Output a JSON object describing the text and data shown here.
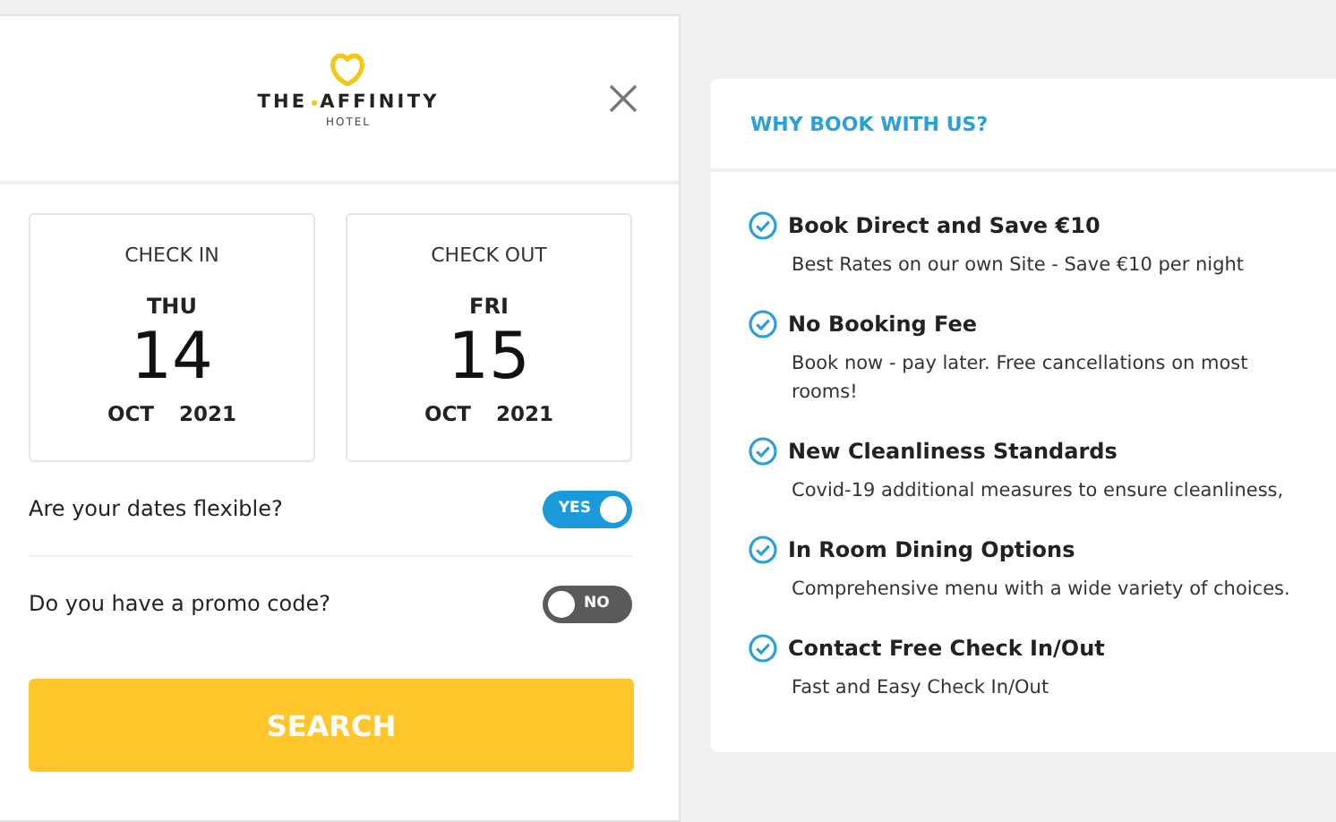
{
  "logo": {
    "words": [
      "THE",
      "AFFINITY"
    ],
    "subtitle": "HOTEL"
  },
  "dates": [
    {
      "label": "CHECK IN",
      "weekday": "THU",
      "day": "14",
      "month": "OCT",
      "year": "2021"
    },
    {
      "label": "CHECK OUT",
      "weekday": "FRI",
      "day": "15",
      "month": "OCT",
      "year": "2021"
    }
  ],
  "options": [
    {
      "question": "Are your dates flexible?",
      "on": true,
      "toggle_label": "YES"
    },
    {
      "question": "Do you have a promo code?",
      "on": false,
      "toggle_label": "NO"
    }
  ],
  "search_button": "SEARCH",
  "benefits": {
    "title": "WHY BOOK WITH US?",
    "items": [
      {
        "title": "Book Direct and Save €10",
        "text": "Best Rates on our own Site - Save €10 per night"
      },
      {
        "title": "No Booking Fee",
        "text": "Book now - pay later. Free cancellations on most rooms!"
      },
      {
        "title": "New Cleanliness Standards",
        "text": "Covid-19 additional measures to ensure cleanliness,"
      },
      {
        "title": "In Room Dining Options",
        "text": "Comprehensive menu with a wide variety of choices."
      },
      {
        "title": "Contact Free Check In/Out",
        "text": "Fast and Easy Check In/Out"
      }
    ]
  }
}
